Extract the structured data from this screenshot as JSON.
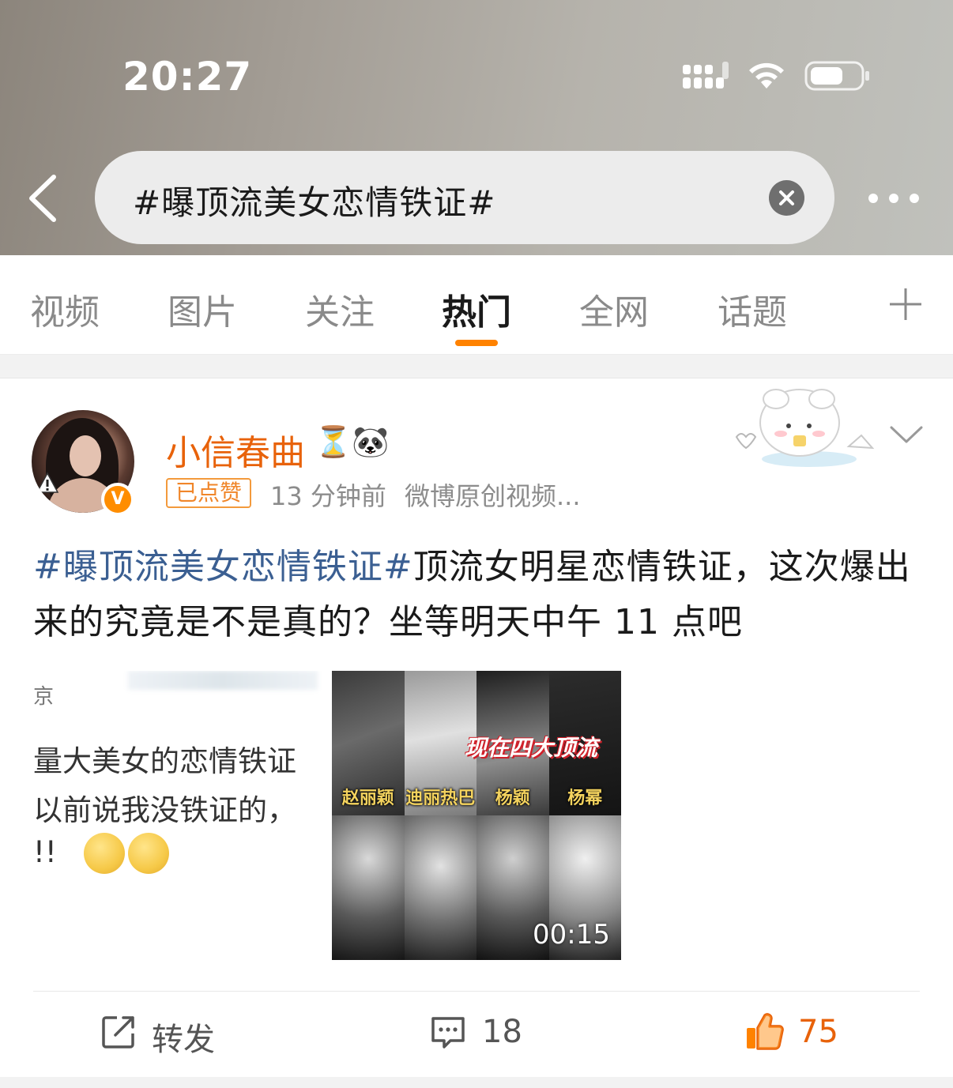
{
  "status_bar": {
    "time": "20:27"
  },
  "search": {
    "query": "#曝顶流美女恋情铁证#"
  },
  "tabs": [
    {
      "label": "视频",
      "active": false
    },
    {
      "label": "图片",
      "active": false
    },
    {
      "label": "关注",
      "active": false
    },
    {
      "label": "热门",
      "active": true
    },
    {
      "label": "全网",
      "active": false
    },
    {
      "label": "话题",
      "active": false
    }
  ],
  "post": {
    "author": {
      "name": "小信春曲",
      "badges_emoji": "⏳🐼",
      "verified_icon": "V"
    },
    "liked_tag": "已点赞",
    "time": "13 分钟前",
    "source": "微博原创视频...",
    "text": {
      "hashtag": "#曝顶流美女恋情铁证#",
      "body": "顶流女明星恋情铁证，这次爆出来的究竟是不是真的？坐等明天中午 11 点吧"
    },
    "media_left": {
      "line1": "京",
      "line2": "量大美女的恋情铁证",
      "line3": "以前说我没铁证的，",
      "line4": "!!"
    },
    "video": {
      "overlay_title": "现在四大顶流",
      "names": [
        "赵丽颖",
        "迪丽热巴",
        "杨颖",
        "杨幂"
      ],
      "duration": "00:15"
    },
    "actions": {
      "repost_label": "转发",
      "comment_count": "18",
      "like_count": "75"
    }
  },
  "colors": {
    "accent_orange": "#ff8200",
    "hashtag_blue": "#3b5f92",
    "username_orange": "#e8620a"
  }
}
